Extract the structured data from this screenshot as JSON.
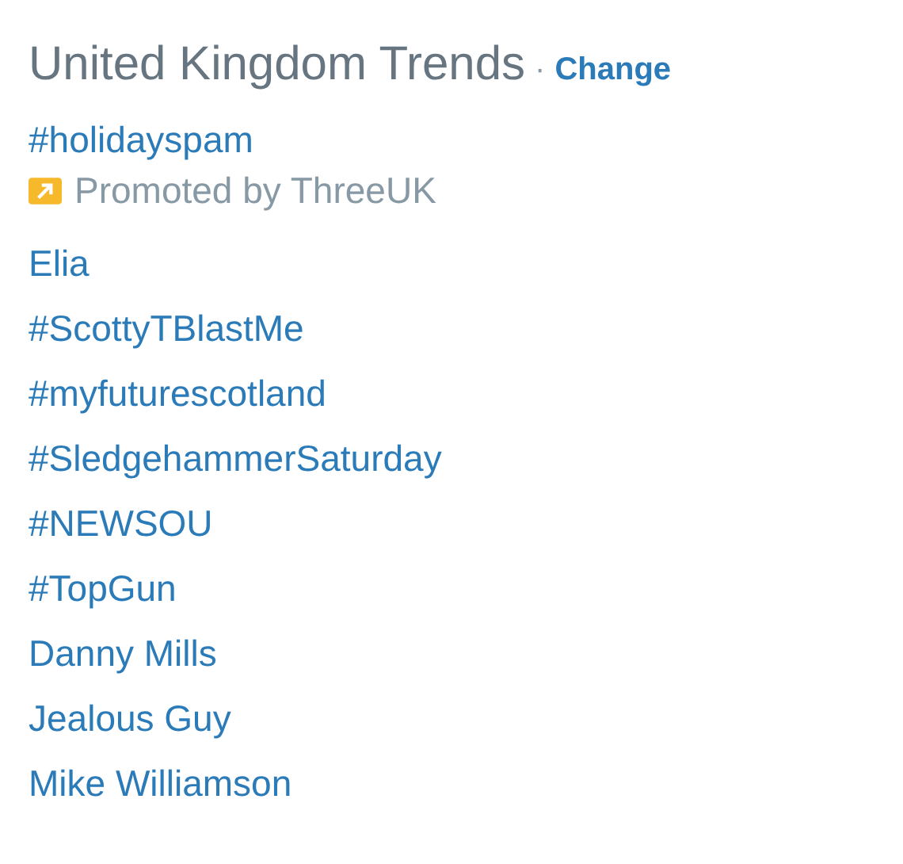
{
  "panel": {
    "title": "United Kingdom Trends",
    "separator": "·",
    "change_link": "Change"
  },
  "trends": [
    {
      "name": "#holidayspam",
      "promoted_by": "Promoted by ThreeUK"
    },
    {
      "name": "Elia"
    },
    {
      "name": "#ScottyTBlastMe"
    },
    {
      "name": "#myfuturescotland"
    },
    {
      "name": "#SledgehammerSaturday"
    },
    {
      "name": "#NEWSOU"
    },
    {
      "name": "#TopGun"
    },
    {
      "name": "Danny Mills"
    },
    {
      "name": "Jealous Guy"
    },
    {
      "name": "Mike Williamson"
    }
  ]
}
